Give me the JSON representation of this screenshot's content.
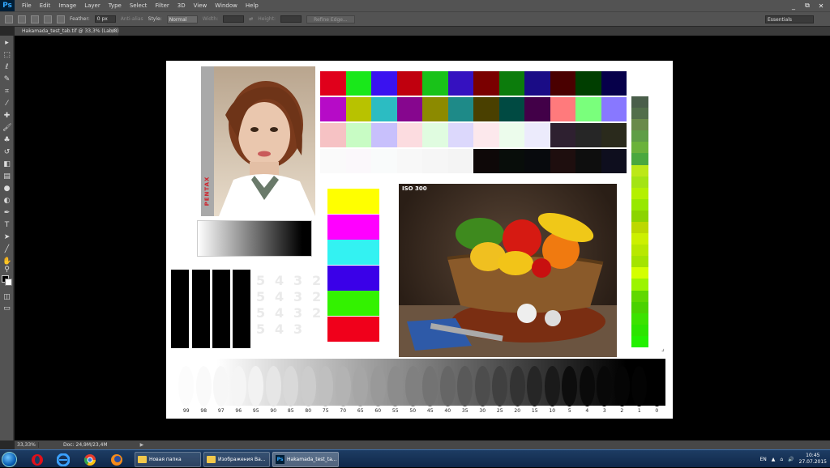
{
  "app": {
    "logo": "Ps",
    "menu": [
      "File",
      "Edit",
      "Image",
      "Layer",
      "Type",
      "Select",
      "Filter",
      "3D",
      "View",
      "Window",
      "Help"
    ],
    "window_buttons": [
      "_",
      "⧉",
      "✕"
    ]
  },
  "options": {
    "feather_label": "Feather:",
    "feather_value": "0 px",
    "antialias_label": "Anti-alias",
    "style_label": "Style:",
    "style_value": "Normal",
    "width_label": "Width:",
    "height_label": "Height:",
    "refine_label": "Refine Edge...",
    "workspace": "Essentials"
  },
  "document": {
    "tab_title": "Hakamada_test_tab.tif @ 33,3% (Lab/8)",
    "tab_close": "×",
    "photo_label": "PENTAX",
    "iso_label": "ISO 300",
    "faded_digits": [
      "5",
      "4",
      "3",
      "2",
      "5",
      "4",
      "3",
      "2",
      "5",
      "4",
      "3",
      "2",
      "5",
      "4",
      "3"
    ]
  },
  "status": {
    "zoom": "33,33%",
    "doc": "Doc: 24,9M/23,4M",
    "arrow": "▶"
  },
  "chart_data": {
    "type": "table",
    "oval_tone_labels": [
      "99",
      "98",
      "97",
      "96",
      "95",
      "90",
      "85",
      "80",
      "75",
      "70",
      "65",
      "60",
      "55",
      "50",
      "45",
      "40",
      "35",
      "30",
      "25",
      "20",
      "15",
      "10",
      "5",
      "4",
      "3",
      "2",
      "1",
      "0"
    ]
  },
  "colors": {
    "grid_row1": [
      "#e0001b",
      "#19e81a",
      "#3a12f0",
      "#c0000e",
      "#19c219",
      "#3511c0",
      "#7a0000",
      "#0c7c0c",
      "#1a0c86",
      "#4a0000",
      "#003e00",
      "#06004a"
    ],
    "grid_row2": [
      "#b60bc7",
      "#b8c200",
      "#2cbcc2",
      "#86068e",
      "#8c8a00",
      "#1e8a88",
      "#4a4000",
      "#004a42",
      "#420048",
      "#ff7a7c",
      "#7aff7c",
      "#8878ff"
    ],
    "grid_row3": [
      "#f6c2c4",
      "#c8fcc4",
      "#c8c0fc",
      "#fcdce0",
      "#e0fce0",
      "#dcd8fc",
      "#fce8ec",
      "#ecfcec",
      "#ecebfc",
      "#2e2030",
      "#262626",
      "#2a2a1c"
    ],
    "grid_row4": [
      "#fafafa",
      "#fbf8fb",
      "#f9fbfb",
      "#f8f8f8",
      "#f6f6f6",
      "#f4f4f4",
      "#0e0808",
      "#080d0a",
      "#080a0d",
      "#1e0e0e",
      "#0e0e0e",
      "#0e0e1e"
    ],
    "verticals": [
      "#4a5e4a",
      "#526e4a",
      "#6a8a4a",
      "#5e9e46",
      "#6ab23a",
      "#4aa83e",
      "#bce818",
      "#a4e414",
      "#b4f000",
      "#98e800",
      "#8cd400",
      "#bcd800",
      "#ccf000",
      "#b8e800",
      "#a4e400",
      "#d4ff00",
      "#9cf400",
      "#60d800",
      "#4ad200",
      "#3ce200",
      "#2ce400",
      "#22f000"
    ],
    "bars5": [
      "#ffff00",
      "#ff00ff",
      "#33f2f2",
      "#3a00e8",
      "#33f200",
      "#f0001b"
    ]
  },
  "taskbar": {
    "tasks": [
      "Новая папка",
      "Изображения Ва...",
      "Hakamada_test_ta..."
    ],
    "lang": "EN",
    "time": "10:45",
    "date": "27.07.2015"
  }
}
